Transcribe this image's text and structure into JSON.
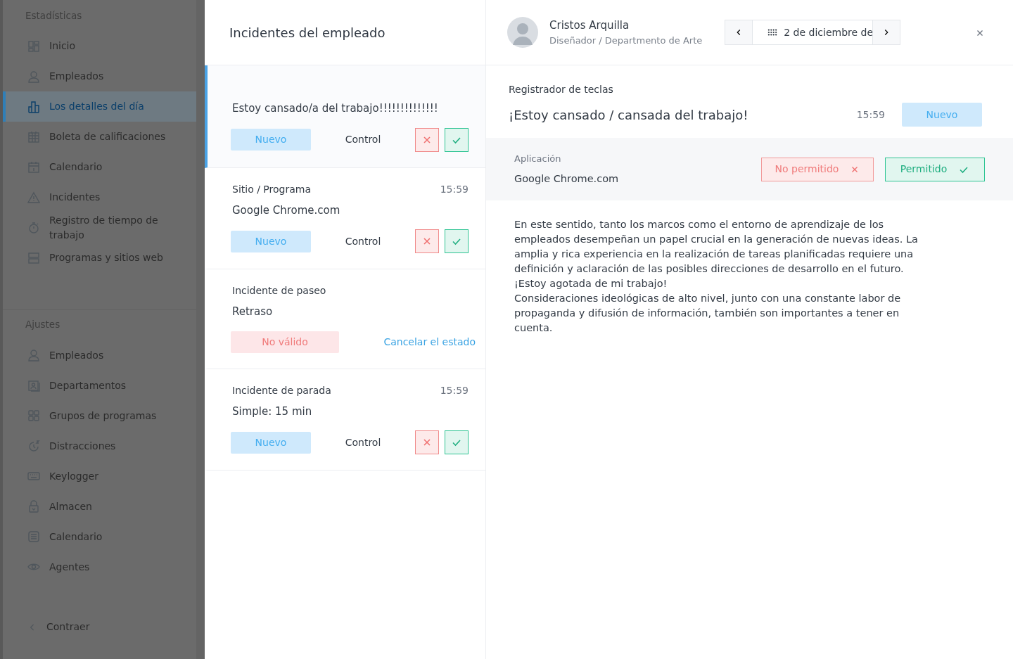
{
  "sidebar": {
    "sections": [
      {
        "title": "Estadísticas",
        "items": [
          {
            "label": "Inicio",
            "selected": false
          },
          {
            "label": "Empleados",
            "selected": false
          },
          {
            "label": "Los detalles del día",
            "selected": true
          },
          {
            "label": "Boleta de calificaciones",
            "selected": false
          },
          {
            "label": "Calendario",
            "selected": false
          },
          {
            "label": "Incidentes",
            "selected": false
          },
          {
            "label": "Registro de tiempo de trabajo",
            "selected": false
          },
          {
            "label": "Programas y sitios web",
            "selected": false
          }
        ]
      },
      {
        "title": "Ajustes",
        "items": [
          {
            "label": "Empleados",
            "selected": false
          },
          {
            "label": "Departamentos",
            "selected": false
          },
          {
            "label": "Grupos de programas",
            "selected": false
          },
          {
            "label": "Distracciones",
            "selected": false
          },
          {
            "label": "Keylogger",
            "selected": false
          },
          {
            "label": "Almacen",
            "selected": false
          },
          {
            "label": "Calendario",
            "selected": false
          },
          {
            "label": "Agentes",
            "selected": false
          }
        ]
      }
    ],
    "collapse": "Contraer"
  },
  "incidents": {
    "title": "Incidentes del empleado",
    "items": [
      {
        "kind": "review",
        "selected": true,
        "text": "Estoy cansado/a del trabajo!!!!!!!!!!!!!!",
        "status": "Nuevo",
        "valid": true,
        "control": "Control"
      },
      {
        "kind": "review",
        "selected": false,
        "label": "Sitio / Programa",
        "time": "15:59",
        "text": "Google Chrome.com",
        "status": "Nuevo",
        "valid": true,
        "control": "Control"
      },
      {
        "kind": "resolved",
        "selected": false,
        "label": "Incidente de paseo",
        "text": "Retraso",
        "status": "No válido",
        "valid": false,
        "link": "Cancelar el estado"
      },
      {
        "kind": "review",
        "selected": false,
        "label": "Incidente de parada",
        "time": "15:59",
        "text": "Simple: 15 min",
        "status": "Nuevo",
        "valid": true,
        "control": "Control"
      }
    ]
  },
  "detail": {
    "employee": {
      "name": "Cristos Arquilla",
      "role": "Diseñador / Departmento de Arte"
    },
    "date": "2 de diciembre de",
    "keylogger": {
      "label": "Registrador de teclas",
      "title": "¡Estoy cansado / cansada del trabajo!",
      "time": "15:59",
      "status": "Nuevo",
      "valid": true
    },
    "application": {
      "label": "Aplicación",
      "value": "Google Chrome.com",
      "deny": "No permitido",
      "allow": "Permitido"
    },
    "paragraphs": [
      "En este sentido, tanto los marcos como el entorno de aprendizaje de los empleados desempeñan un papel crucial en la generación de nuevas ideas. La amplia y rica experiencia en la realización de tareas planificadas requiere una definición y aclaración de las posibles direcciones de desarrollo en el futuro.",
      "¡Estoy agotada de mi trabajo!",
      "Consideraciones ideológicas de alto nivel, junto con una constante labor de propaganda y difusión de información, también son importantes a tener en cuenta."
    ]
  }
}
